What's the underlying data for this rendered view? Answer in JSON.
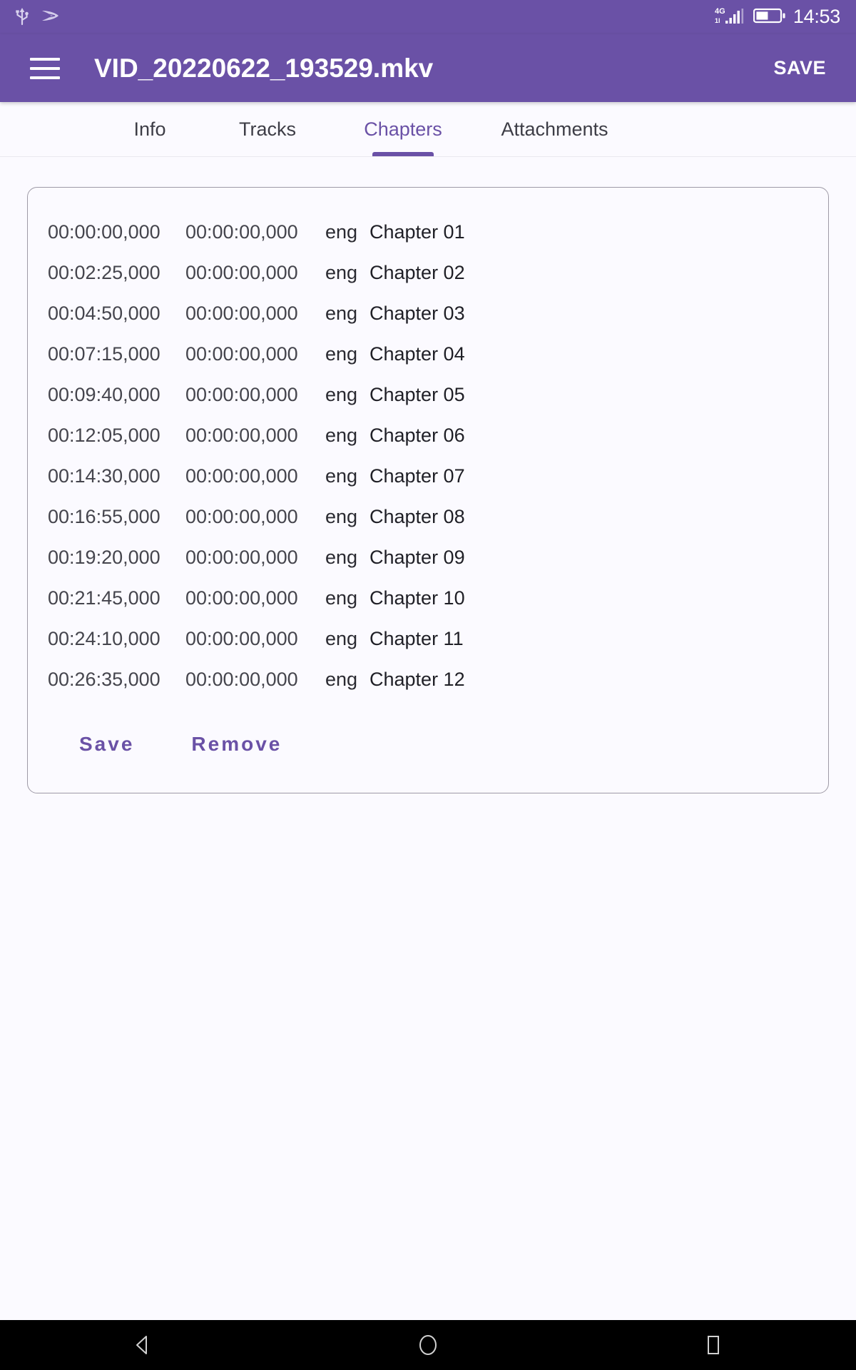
{
  "status_bar": {
    "icons_left": [
      "usb-icon",
      "cast-icon"
    ],
    "network_label": "4G",
    "signal_icon": "signal-bars-icon",
    "battery_icon": "battery-icon",
    "clock": "14:53"
  },
  "app_bar": {
    "menu_icon": "hamburger-menu-icon",
    "title": "VID_20220622_193529.mkv",
    "save_label": "SAVE"
  },
  "tabs": {
    "active_index": 2,
    "items": [
      {
        "label": "Info"
      },
      {
        "label": "Tracks"
      },
      {
        "label": "Chapters"
      },
      {
        "label": "Attachments"
      }
    ]
  },
  "chapters": {
    "rows": [
      {
        "start": "00:00:00,000",
        "end": "00:00:00,000",
        "lang": "eng",
        "name": "Chapter 01"
      },
      {
        "start": "00:02:25,000",
        "end": "00:00:00,000",
        "lang": "eng",
        "name": "Chapter 02"
      },
      {
        "start": "00:04:50,000",
        "end": "00:00:00,000",
        "lang": "eng",
        "name": "Chapter 03"
      },
      {
        "start": "00:07:15,000",
        "end": "00:00:00,000",
        "lang": "eng",
        "name": "Chapter 04"
      },
      {
        "start": "00:09:40,000",
        "end": "00:00:00,000",
        "lang": "eng",
        "name": "Chapter 05"
      },
      {
        "start": "00:12:05,000",
        "end": "00:00:00,000",
        "lang": "eng",
        "name": "Chapter 06"
      },
      {
        "start": "00:14:30,000",
        "end": "00:00:00,000",
        "lang": "eng",
        "name": "Chapter 07"
      },
      {
        "start": "00:16:55,000",
        "end": "00:00:00,000",
        "lang": "eng",
        "name": "Chapter 08"
      },
      {
        "start": "00:19:20,000",
        "end": "00:00:00,000",
        "lang": "eng",
        "name": "Chapter 09"
      },
      {
        "start": "00:21:45,000",
        "end": "00:00:00,000",
        "lang": "eng",
        "name": "Chapter 10"
      },
      {
        "start": "00:24:10,000",
        "end": "00:00:00,000",
        "lang": "eng",
        "name": "Chapter 11"
      },
      {
        "start": "00:26:35,000",
        "end": "00:00:00,000",
        "lang": "eng",
        "name": "Chapter 12"
      }
    ],
    "save_label": "Save",
    "remove_label": "Remove"
  },
  "nav_bar": {
    "back_icon": "back-triangle-icon",
    "home_icon": "home-circle-icon",
    "recents_icon": "recents-square-icon"
  },
  "colors": {
    "primary": "#6a51a6",
    "background": "#fbfaff",
    "nav_bar": "#000000",
    "text": "#2f2f36"
  }
}
